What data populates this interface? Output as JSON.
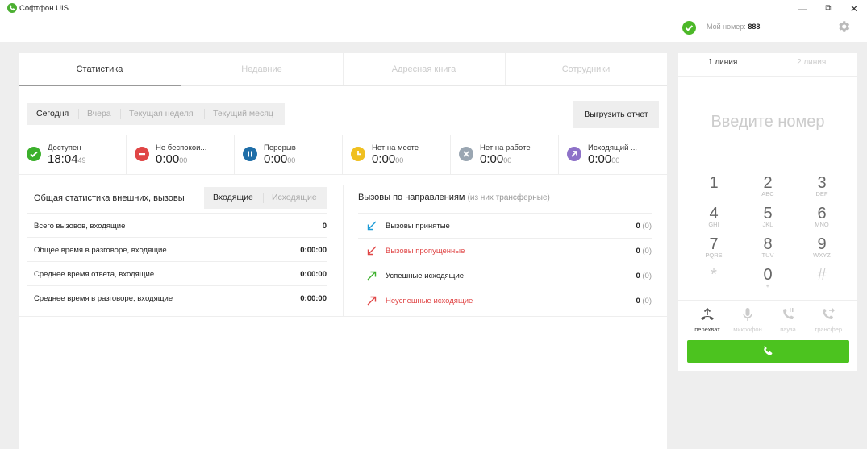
{
  "app": {
    "title": "Софтфон UIS"
  },
  "window_controls": {
    "minimize": "—",
    "restore": "⧉",
    "close": "✕"
  },
  "header": {
    "my_number_label": "Мой номер:",
    "my_number": "888"
  },
  "tabs": [
    {
      "label": "Статистика",
      "active": true
    },
    {
      "label": "Недавние"
    },
    {
      "label": "Адресная книга"
    },
    {
      "label": "Сотрудники"
    }
  ],
  "periods": [
    "Сегодня",
    "Вчера",
    "Текущая неделя",
    "Текущий месяц"
  ],
  "export_label": "Выгрузить отчет",
  "statuses": [
    {
      "label": "Доступен",
      "time": "18:04",
      "sec": "49",
      "color": "#3cb02c",
      "icon": "check-icon"
    },
    {
      "label": "Не беспокои...",
      "time": "0:00",
      "sec": "00",
      "color": "#e04646",
      "icon": "minus-icon"
    },
    {
      "label": "Перерыв",
      "time": "0:00",
      "sec": "00",
      "color": "#1f6ea8",
      "icon": "pause-icon"
    },
    {
      "label": "Нет на месте",
      "time": "0:00",
      "sec": "00",
      "color": "#f0c020",
      "icon": "clock-icon"
    },
    {
      "label": "Нет на работе",
      "time": "0:00",
      "sec": "00",
      "color": "#9aa6b2",
      "icon": "x-icon"
    },
    {
      "label": "Исходящий ...",
      "time": "0:00",
      "sec": "00",
      "color": "#8e72c8",
      "icon": "arrow-up-right-icon"
    }
  ],
  "general": {
    "title": "Общая статистика внешних, вызовы",
    "dir_in": "Входящие",
    "dir_out": "Исходящие",
    "rows": [
      {
        "label": "Всего вызовов, входящие",
        "value": "0"
      },
      {
        "label": "Общее время в разговоре, входящие",
        "value": "0:00:00"
      },
      {
        "label": "Среднее время ответа, входящие",
        "value": "0:00:00"
      },
      {
        "label": "Среднее время в разговоре, входящие",
        "value": "0:00:00"
      }
    ]
  },
  "directions": {
    "title": "Вызовы по направлениям",
    "subtitle": "(из них трансферные)",
    "rows": [
      {
        "label": "Вызовы принятые",
        "value": "0",
        "sub": "(0)",
        "color": "#1a9ad6",
        "icon": "arrow-in-icon",
        "label_color": "#222"
      },
      {
        "label": "Вызовы пропущенные",
        "value": "0",
        "sub": "(0)",
        "color": "#e04646",
        "icon": "arrow-missed-icon",
        "label_color": "#e04646"
      },
      {
        "label": "Успешные исходящие",
        "value": "0",
        "sub": "(0)",
        "color": "#3cb02c",
        "icon": "arrow-out-icon",
        "label_color": "#222"
      },
      {
        "label": "Неуспешные исходящие",
        "value": "0",
        "sub": "(0)",
        "color": "#e04646",
        "icon": "arrow-out-fail-icon",
        "label_color": "#e04646"
      }
    ]
  },
  "lines": [
    {
      "label": "1 линия",
      "active": true
    },
    {
      "label": "2 линия"
    }
  ],
  "dialpad": {
    "placeholder": "Введите номер",
    "keys": [
      {
        "num": "1",
        "sub": ""
      },
      {
        "num": "2",
        "sub": "ABC"
      },
      {
        "num": "3",
        "sub": "DEF"
      },
      {
        "num": "4",
        "sub": "GHI"
      },
      {
        "num": "5",
        "sub": "JKL"
      },
      {
        "num": "6",
        "sub": "MNO"
      },
      {
        "num": "7",
        "sub": "PQRS"
      },
      {
        "num": "8",
        "sub": "TUV"
      },
      {
        "num": "9",
        "sub": "WXYZ"
      },
      {
        "num": "*",
        "sub": ""
      },
      {
        "num": "0",
        "sub": "+"
      },
      {
        "num": "#",
        "sub": ""
      }
    ]
  },
  "actions": [
    {
      "label": "перехват",
      "icon": "intercept-icon",
      "enabled": true
    },
    {
      "label": "микрофон",
      "icon": "mic-icon",
      "enabled": false
    },
    {
      "label": "пауза",
      "icon": "hold-icon",
      "enabled": false
    },
    {
      "label": "трансфер",
      "icon": "transfer-icon",
      "enabled": false
    }
  ],
  "colors": {
    "accent": "#4cc31f",
    "page_bg": "#eeeeee"
  }
}
